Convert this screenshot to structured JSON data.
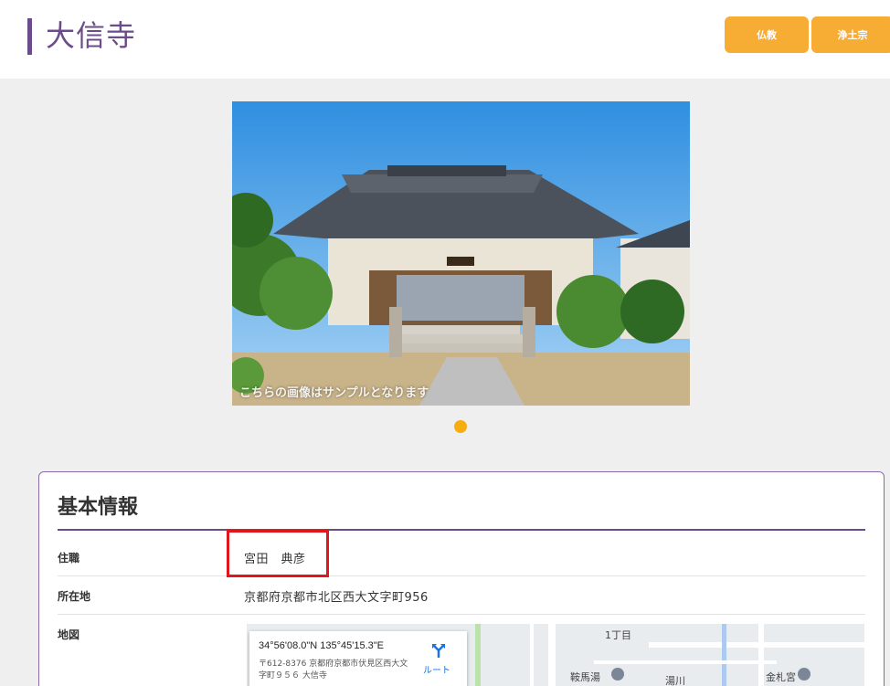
{
  "header": {
    "title": "大信寺",
    "tags": [
      "仏教",
      "浄土宗"
    ]
  },
  "hero": {
    "caption": "こちらの画像はサンプルとなります"
  },
  "info": {
    "heading": "基本情報",
    "rows": [
      {
        "label": "住職",
        "value": "宮田　典彦"
      },
      {
        "label": "所在地",
        "value": "京都府京都市北区西大文字町956"
      },
      {
        "label": "地図",
        "value": ""
      }
    ]
  },
  "map": {
    "coords": "34°56'08.0\"N 135°45'15.3\"E",
    "address": "〒612-8376 京都府京都市伏見区西大文字町９５６ 大信寺",
    "route_label": "ルート",
    "labels": [
      "1丁目",
      "鞍馬湯",
      "金札宮",
      "湯川"
    ]
  },
  "colors": {
    "accent": "#6b4c8a",
    "tag": "#f7ac33",
    "highlight": "#e0161c"
  }
}
